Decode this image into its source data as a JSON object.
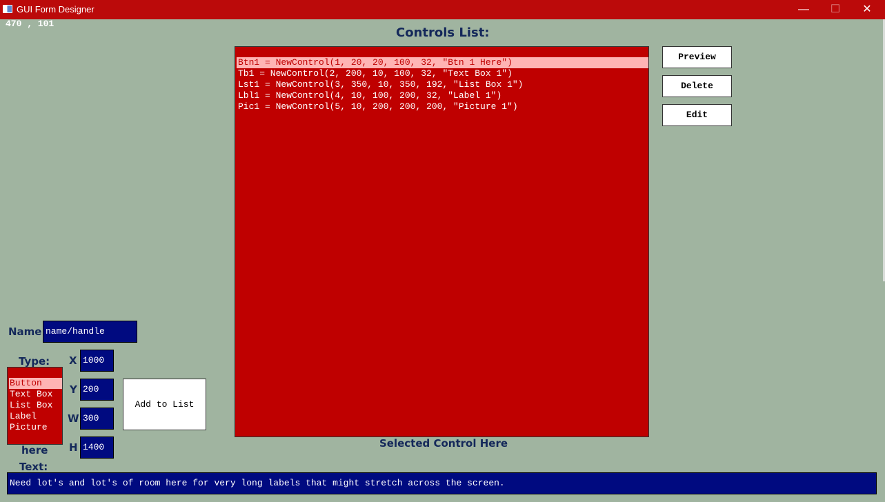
{
  "window": {
    "title": "GUI Form Designer",
    "minimize": "—",
    "maximize": "☐",
    "close": "✕"
  },
  "mouse_coords": "470 , 101",
  "controls_list": {
    "heading": "Controls List:",
    "items": [
      "Btn1 = NewControl(1, 20, 20, 100, 32, \"Btn 1 Here\")",
      "Tb1 = NewControl(2, 200, 10, 100, 32, \"Text Box 1\")",
      "Lst1 = NewControl(3, 350, 10, 350, 192, \"List Box 1\")",
      "Lbl1 = NewControl(4, 10, 100, 200, 32, \"Label 1\")",
      "Pic1 = NewControl(5, 10, 200, 200, 200, \"Picture 1\")"
    ],
    "selected_index": 0,
    "footer": "Selected Control Here"
  },
  "side_buttons": {
    "preview": "Preview",
    "delete": "Delete",
    "edit": "Edit"
  },
  "form": {
    "name_label": "Name",
    "name_value": "name/handle",
    "type_label": "Type:",
    "type_options": [
      "Button",
      "Text Box",
      "List Box",
      "Label",
      "Picture"
    ],
    "type_selected_index": 0,
    "type_caption": "here",
    "x_label": "X",
    "x_value": "1000",
    "y_label": "Y",
    "y_value": "200",
    "w_label": "W",
    "w_value": "300",
    "h_label": "H",
    "h_value": "1400",
    "add_button": "Add to List",
    "text_label": "Text:",
    "text_value": "Need lot's and lot's of room here for very long labels that might stretch across the screen."
  }
}
